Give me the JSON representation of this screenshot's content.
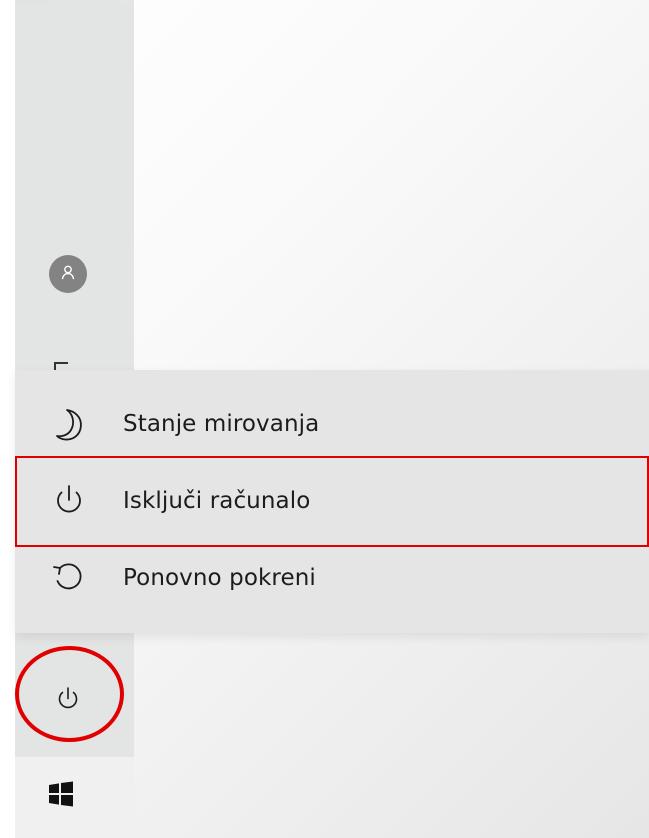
{
  "power_menu": {
    "items": [
      {
        "label": "Stanje mirovanja",
        "icon": "moon-icon"
      },
      {
        "label": "Isključi računalo",
        "icon": "power-icon"
      },
      {
        "label": "Ponovno pokreni",
        "icon": "restart-icon"
      }
    ],
    "highlighted_index": 1
  },
  "rail": {
    "user_icon": "user-avatar-icon",
    "power_icon": "power-icon",
    "start_icon": "windows-logo-icon"
  },
  "colors": {
    "annotation": "#e10000",
    "menu_background": "#e5e5e5",
    "rail_background": "#e3e4e4",
    "text": "#1c1c1c"
  }
}
